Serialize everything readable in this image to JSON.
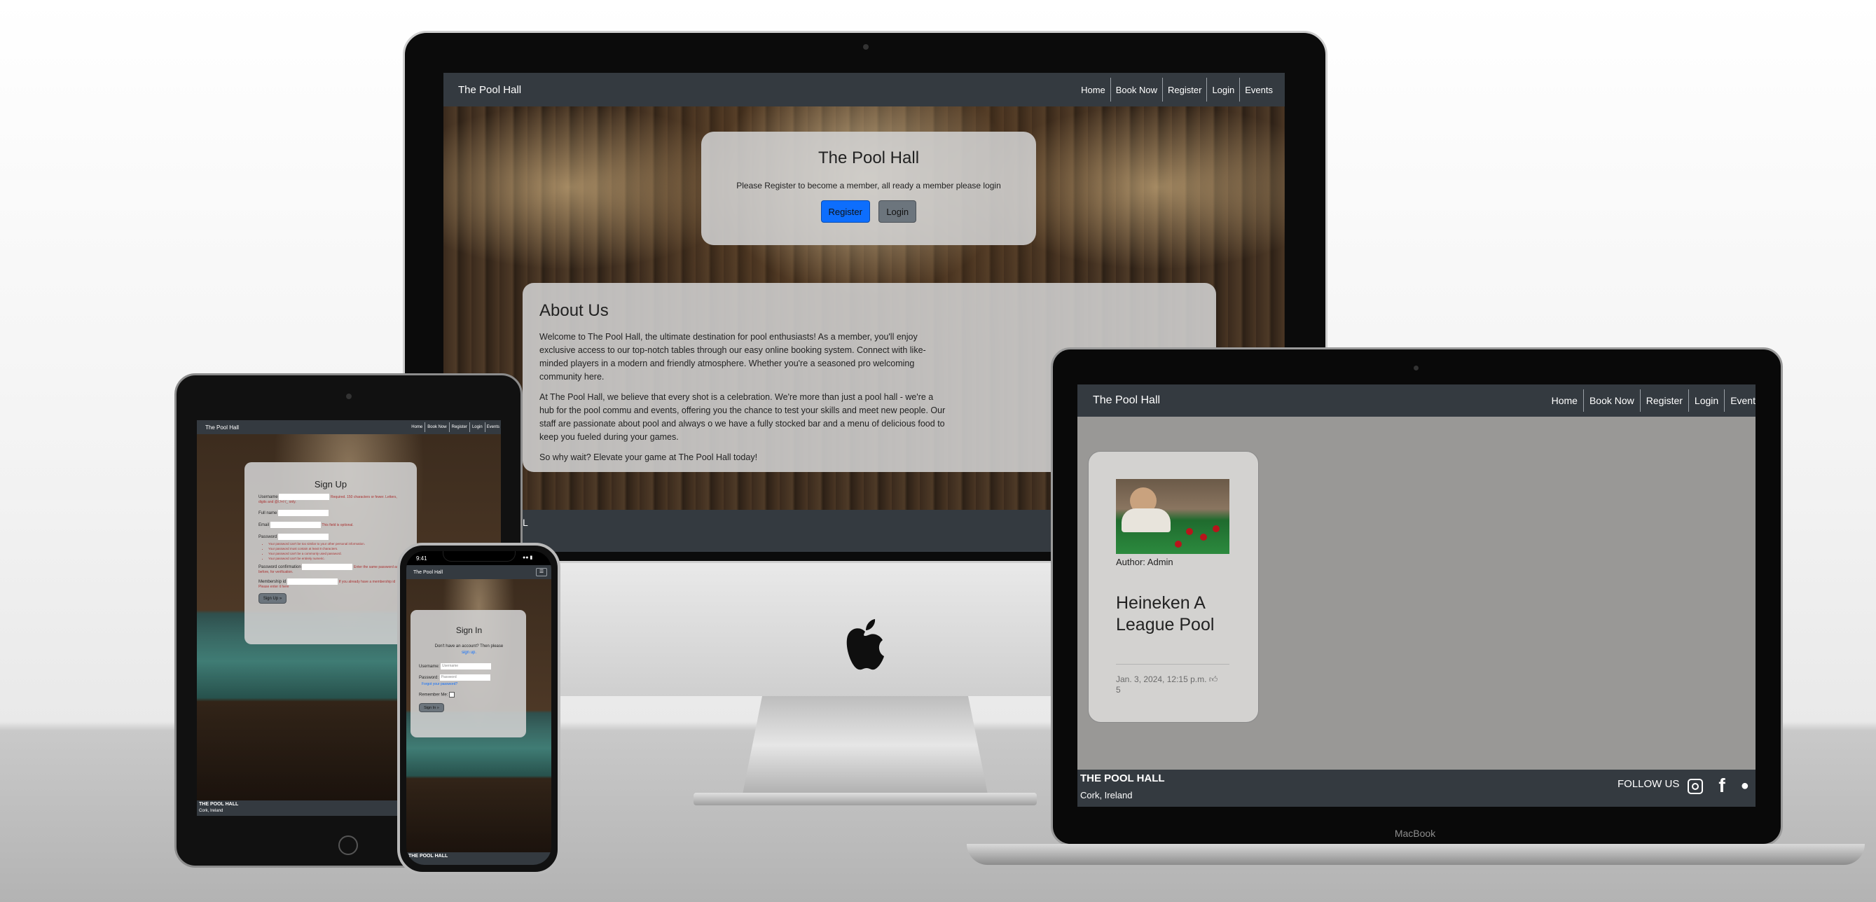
{
  "site": {
    "brand": "The Pool Hall",
    "nav": [
      "Home",
      "Book Now",
      "Register",
      "Login",
      "Events"
    ]
  },
  "imac": {
    "hero_title": "The Pool Hall",
    "hero_text": "Please Register to become a member, all ready a member please login",
    "register_label": "Register",
    "login_label": "Login",
    "about_title": "About Us",
    "about_p1": "Welcome to The Pool Hall, the ultimate destination for pool enthusiasts! As a member, you'll enjoy exclusive access to our top-notch tables through our easy online booking system. Connect with like-minded players in a modern and friendly atmosphere. Whether you're a seasoned pro welcoming community here.",
    "about_p2": "At The Pool Hall, we believe that every shot is a celebration. We're more than just a pool hall - we're a hub for the pool commu and events, offering you the chance to test your skills and meet new people. Our staff are passionate about pool and always o we have a fully stocked bar and a menu of delicious food to keep you fueled during your games.",
    "about_p3": "So why wait? Elevate your game at The Pool Hall today!",
    "footer_fragment": "L"
  },
  "macbook": {
    "nav": [
      "Home",
      "Book Now",
      "Register",
      "Login",
      "Event"
    ],
    "post_author": "Author: Admin",
    "post_title": "Heineken A League Pool",
    "post_meta": "Jan. 3, 2024, 12:15 p.m.",
    "post_likes": "5",
    "footer_title": "THE POOL HALL",
    "footer_location": "Cork, Ireland",
    "follow_label": "FOLLOW US",
    "label": "MacBook"
  },
  "ipad": {
    "form_title": "Sign Up",
    "fields": [
      "Username",
      "Full name",
      "Email",
      "Password",
      "Password confirmation",
      "Membership id"
    ],
    "username_help": "Required. 150 characters or fewer. Letters, digits and @/./+/-/_ only.",
    "email_help": "This field is optional.",
    "password_rules": [
      "Your password can't be too similar to your other personal information.",
      "Your password must contain at least 8 characters.",
      "Your password can't be a commonly used password.",
      "Your password can't be entirely numeric."
    ],
    "confirm_help": "Enter the same password as before, for verification.",
    "membership_help": "If you already have a membership id Please enter it here",
    "submit": "Sign Up »",
    "footer_title": "THE POOL HALL",
    "footer_location": "Cork, Ireland"
  },
  "iphone": {
    "time": "9:41",
    "form_title": "Sign In",
    "prompt": "Don't have an account? Then please",
    "signup_link": "sign up.",
    "username_label": "Username:",
    "username_placeholder": "Username",
    "password_label": "Password:",
    "password_placeholder": "Password",
    "forgot": "Forgot your password?",
    "remember": "Remember Me:",
    "submit": "Sign In »",
    "footer_title": "THE POOL HALL"
  },
  "colors": {
    "navbar": "#343a40",
    "primary_button": "#0d6efd",
    "secondary_button": "#6c757d",
    "card": "#d2d2d2"
  }
}
